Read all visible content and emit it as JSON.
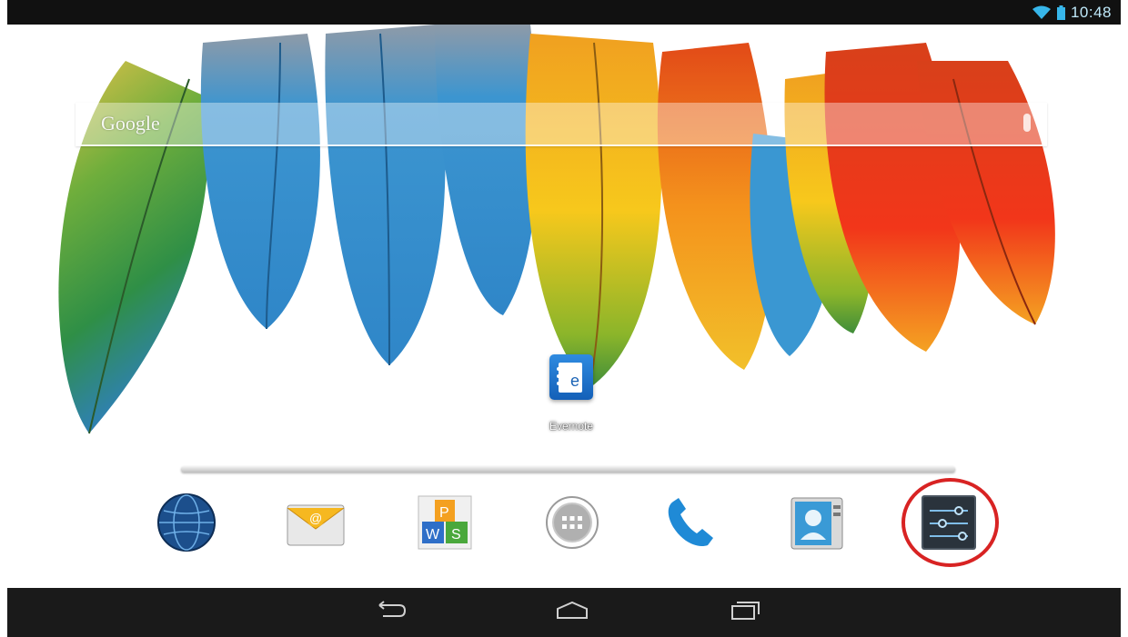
{
  "status_bar": {
    "time": "10:48",
    "icons": [
      "wifi-icon",
      "battery-icon"
    ]
  },
  "search": {
    "placeholder": "Google",
    "icons": [
      "mic-icon"
    ]
  },
  "home_app": {
    "label": "Evernote",
    "icon": "evernote-icon"
  },
  "dock": [
    {
      "name": "browser",
      "icon": "globe-icon"
    },
    {
      "name": "email",
      "icon": "email-icon"
    },
    {
      "name": "wps-office",
      "icon": "wps-office-icon"
    },
    {
      "name": "app-drawer",
      "icon": "app-drawer-icon"
    },
    {
      "name": "phone",
      "icon": "phone-icon"
    },
    {
      "name": "contacts",
      "icon": "contacts-icon"
    },
    {
      "name": "settings",
      "icon": "settings-icon",
      "highlighted": true
    }
  ],
  "nav_bar": {
    "buttons": [
      "back-icon",
      "home-icon",
      "recents-icon"
    ]
  },
  "colors": {
    "highlight_ring": "#d82323",
    "status_accent": "#7fd4f5"
  }
}
